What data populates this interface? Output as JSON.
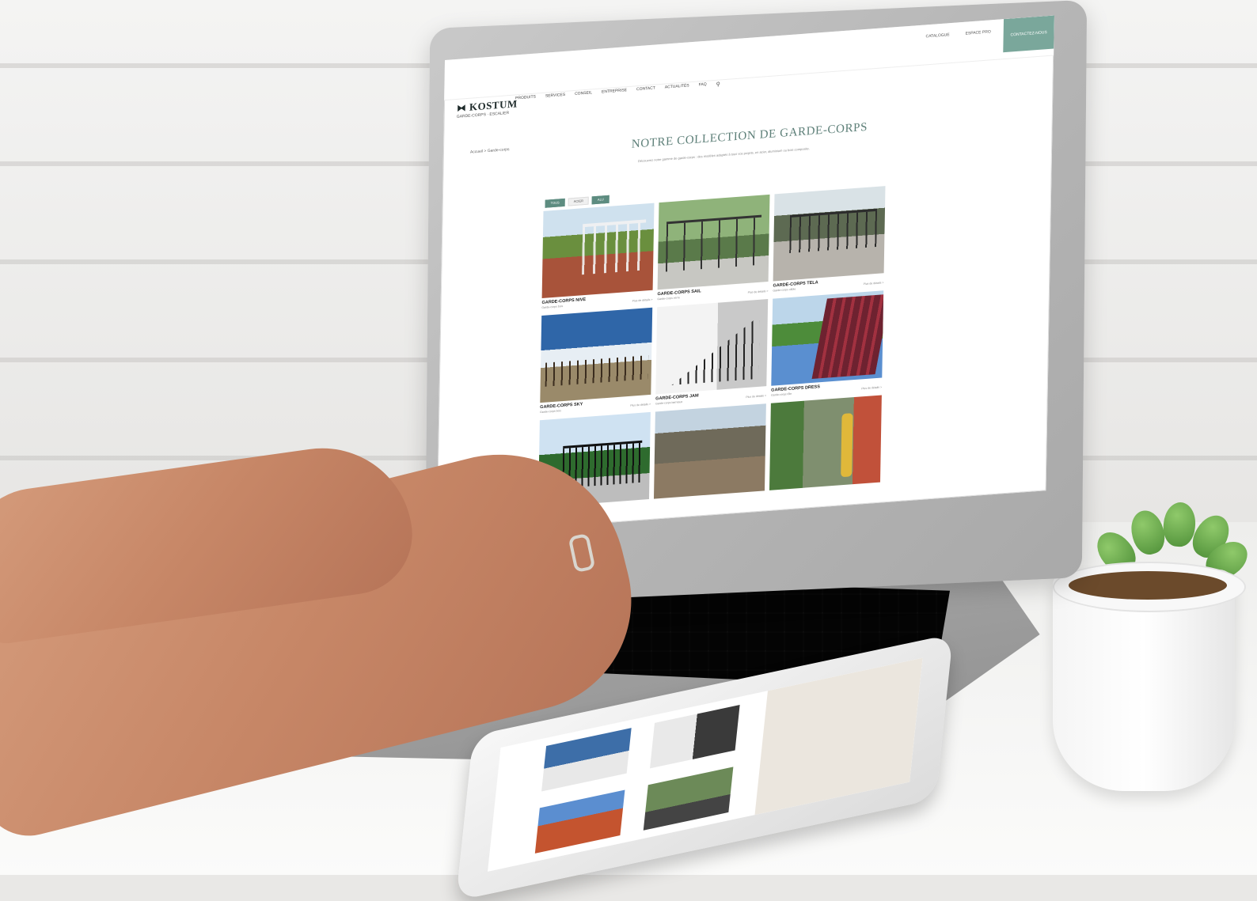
{
  "site": {
    "logo": {
      "text": "KOSTUM",
      "tagline": "GARDE-CORPS · ESCALIER"
    },
    "nav": [
      "PRODUITS",
      "SERVICES",
      "CONSEIL",
      "ENTREPRISE",
      "CONTACT",
      "ACTUALITÉS",
      "FAQ"
    ],
    "header_links": [
      "CATALOGUE",
      "ESPACE PRO"
    ],
    "cta": "CONTACTEZ-NOUS",
    "breadcrumb": "Accueil > Garde-corps",
    "page_title": "NOTRE COLLECTION DE GARDE-CORPS",
    "intro": "Découvrez notre gamme de garde-corps : des modèles adaptés à tous vos projets, en acier, aluminium ou bois composite.",
    "filters": [
      {
        "label": "TOUS",
        "active": true
      },
      {
        "label": "ACIER",
        "active": false
      },
      {
        "label": "ALU",
        "active": true
      }
    ],
    "products": [
      {
        "name": "GARDE-CORPS NIVE",
        "subtitle": "Garde-corps bois",
        "link": "Plus de détails >"
      },
      {
        "name": "GARDE-CORPS SAIL",
        "subtitle": "Garde-corps verre",
        "link": "Plus de détails >"
      },
      {
        "name": "GARDE-CORPS TELA",
        "subtitle": "Garde-corps câble",
        "link": "Plus de détails >"
      },
      {
        "name": "GARDE-CORPS SKY",
        "subtitle": "Garde-corps bois",
        "link": "Plus de détails >"
      },
      {
        "name": "GARDE-CORPS JAM",
        "subtitle": "Garde-corps barreaux",
        "link": "Plus de détails >"
      },
      {
        "name": "GARDE-CORPS DRESS",
        "subtitle": "Garde-corps tôle",
        "link": "Plus de détails >"
      },
      {
        "name": "",
        "subtitle": "",
        "link": ""
      },
      {
        "name": "",
        "subtitle": "",
        "link": ""
      },
      {
        "name": "",
        "subtitle": "",
        "link": ""
      }
    ]
  },
  "colors": {
    "accent": "#7aa79b",
    "title": "#5d7f78",
    "filter_active": "#5d8c80"
  }
}
